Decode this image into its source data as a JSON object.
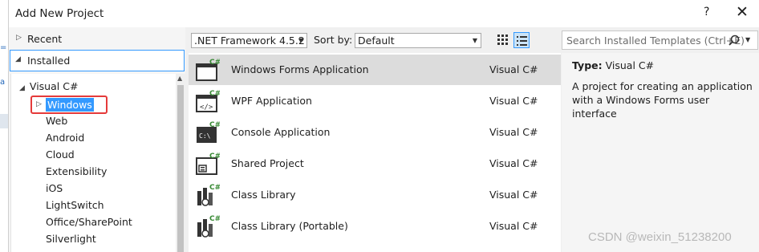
{
  "window": {
    "title": "Add New Project",
    "help_label": "?",
    "close_label": "✕"
  },
  "gutter": {
    "char1": "=",
    "char2": "a"
  },
  "nav": {
    "recent": "Recent",
    "installed": "Installed",
    "tree": {
      "root": "Visual C#",
      "selected": "Windows",
      "children": [
        "Web",
        "Android",
        "Cloud",
        "Extensibility",
        "iOS",
        "LightSwitch",
        "Office/SharePoint",
        "Silverlight"
      ]
    }
  },
  "toolbar": {
    "framework": ".NET Framework 4.5.2",
    "sort_label": "Sort by:",
    "sort_value": "Default"
  },
  "templates": [
    {
      "name": "Windows Forms Application",
      "lang": "Visual C#",
      "icon": "winforms-icon",
      "selected": true
    },
    {
      "name": "WPF Application",
      "lang": "Visual C#",
      "icon": "wpf-icon",
      "selected": false
    },
    {
      "name": "Console Application",
      "lang": "Visual C#",
      "icon": "console-icon",
      "selected": false
    },
    {
      "name": "Shared Project",
      "lang": "Visual C#",
      "icon": "shared-project-icon",
      "selected": false
    },
    {
      "name": "Class Library",
      "lang": "Visual C#",
      "icon": "class-library-icon",
      "selected": false
    },
    {
      "name": "Class Library (Portable)",
      "lang": "Visual C#",
      "icon": "portable-class-library-icon",
      "selected": false
    }
  ],
  "search": {
    "placeholder": "Search Installed Templates (Ctrl+E)"
  },
  "details": {
    "type_label": "Type:",
    "type_value": "Visual C#",
    "description": "A project for creating an application with a Windows Forms user interface"
  },
  "watermark": "CSDN @weixin_51238200",
  "colors": {
    "selection": "#3399ff",
    "highlight_box": "#e53a3a",
    "row_selected": "#dcdcdc",
    "csharp_green": "#388a34"
  }
}
